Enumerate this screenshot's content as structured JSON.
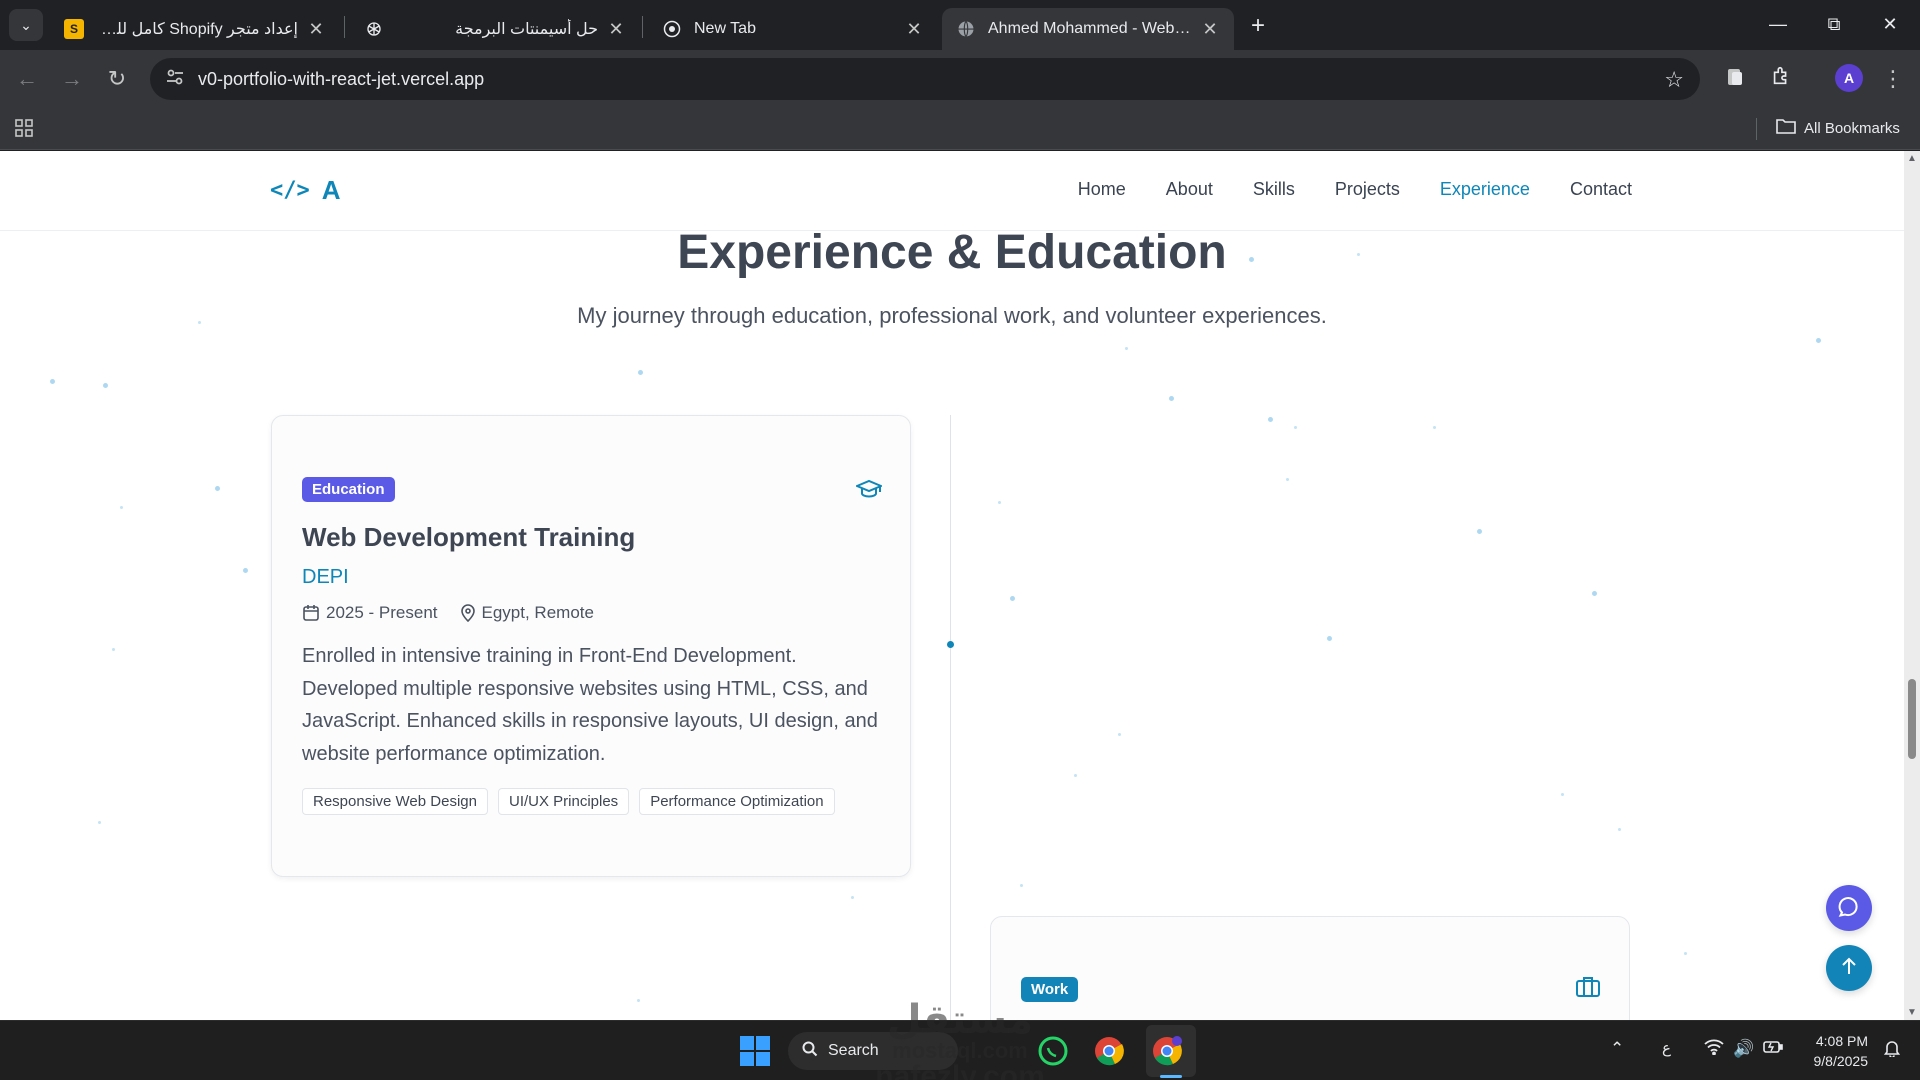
{
  "tabs": [
    {
      "favicon": "S",
      "title": "إعداد متجر Shopify كامل للدروبشي",
      "rtl": true
    },
    {
      "favicon": "chatgpt-icon",
      "title": "حل أسيمنتات البرمجة",
      "rtl": true
    },
    {
      "favicon": "chrome-icon",
      "title": "New Tab",
      "rtl": false
    },
    {
      "favicon": "globe-icon",
      "title": "Ahmed Mohammed - Web Dev",
      "rtl": false,
      "active": true
    }
  ],
  "toolbar": {
    "url": "v0-portfolio-with-react-jet.vercel.app",
    "profile_initial": "A"
  },
  "bookmarks": {
    "all_label": "All Bookmarks"
  },
  "site": {
    "logo_code": "</>",
    "logo_letter": "A",
    "nav": [
      "Home",
      "About",
      "Skills",
      "Projects",
      "Experience",
      "Contact"
    ],
    "active_nav": "Experience",
    "section_title": "Experience & Education",
    "section_subtitle": "My journey through education, professional work, and volunteer experiences.",
    "card1": {
      "badge": "Education",
      "title": "Web Development Training",
      "org": "DEPI",
      "date": "2025 - Present",
      "location": "Egypt, Remote",
      "description": "Enrolled in intensive training in Front-End Development. Developed multiple responsive websites using HTML, CSS, and JavaScript. Enhanced skills in responsive layouts, UI design, and website performance optimization.",
      "tags": [
        "Responsive Web Design",
        "UI/UX Principles",
        "Performance Optimization"
      ]
    },
    "card2": {
      "badge": "Work"
    }
  },
  "taskbar": {
    "search_label": "Search",
    "ime": "ع",
    "time": "4:08 PM",
    "date": "9/8/2025"
  },
  "watermark": {
    "line1": "مستقل",
    "line2": "mostaql.com",
    "line3": "nafezly.com"
  },
  "colors": {
    "accent": "#0e86b8",
    "badge_education": "#5a5ae6",
    "badge_work": "#1384b8"
  }
}
